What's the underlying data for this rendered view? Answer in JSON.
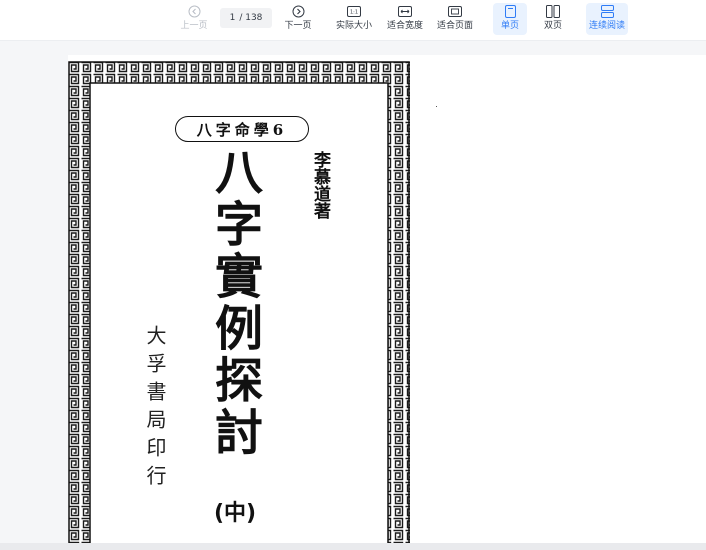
{
  "toolbar": {
    "prev_label": "上一页",
    "page_current": "1",
    "page_total": "/ 138",
    "next_label": "下一页",
    "actual_size_label": "实际大小",
    "fit_width_label": "适合宽度",
    "fit_page_label": "适合页面",
    "single_page_label": "单页",
    "double_page_label": "双页",
    "continuous_label": "连续阅读",
    "accent_color": "#2f7cf6"
  },
  "document": {
    "series": "八字命學6",
    "author": "李慕道著",
    "title": "八字實例探討",
    "volume": "(中)",
    "publisher": "大孚書局印行"
  }
}
